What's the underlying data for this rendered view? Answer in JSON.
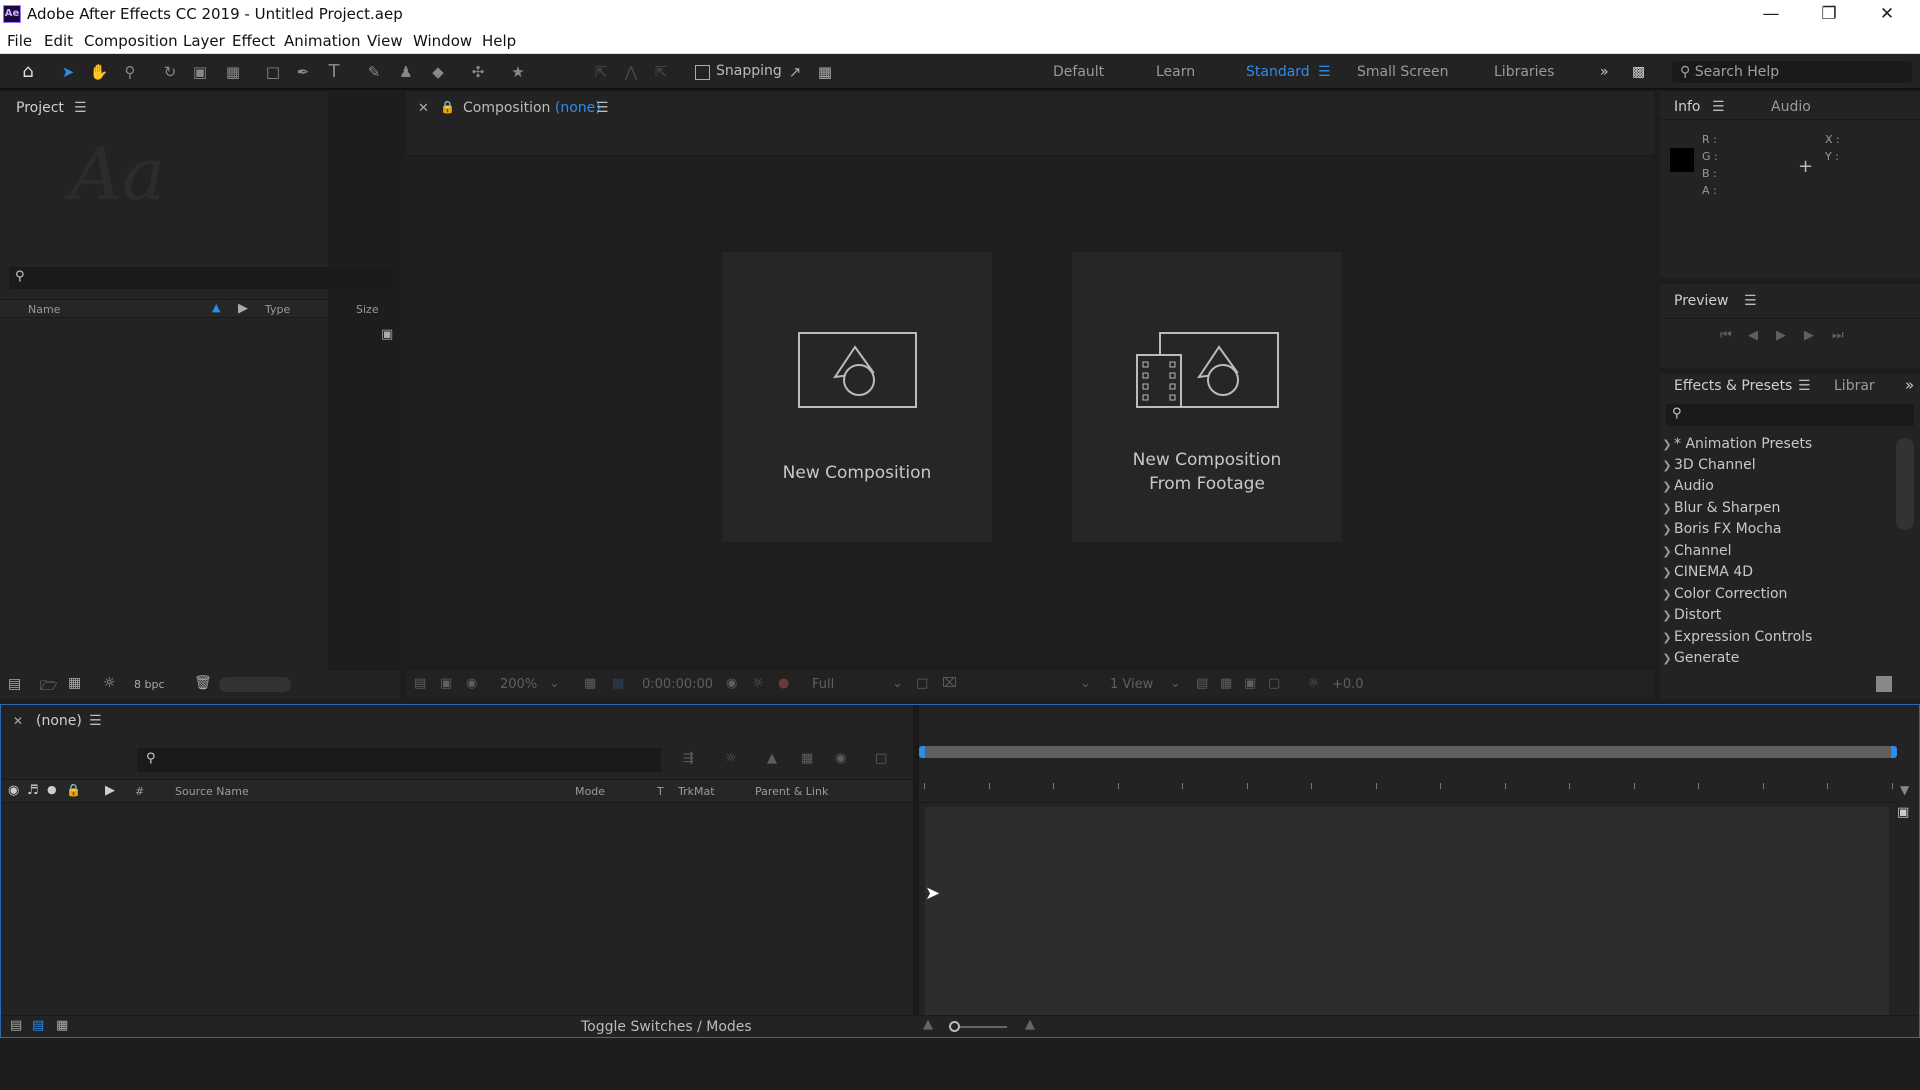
{
  "window": {
    "title": "Adobe After Effects CC 2019 - Untitled Project.aep",
    "app_icon": "Ae"
  },
  "menu": [
    "File",
    "Edit",
    "Composition",
    "Layer",
    "Effect",
    "Animation",
    "View",
    "Window",
    "Help"
  ],
  "toolbar": {
    "snapping_label": "Snapping",
    "workspaces": [
      {
        "label": "Default",
        "active": false
      },
      {
        "label": "Learn",
        "active": false
      },
      {
        "label": "Standard",
        "active": true
      },
      {
        "label": "Small Screen",
        "active": false
      },
      {
        "label": "Libraries",
        "active": false
      }
    ],
    "search_placeholder": "Search Help"
  },
  "project": {
    "title": "Project",
    "columns": {
      "name": "Name",
      "type": "Type",
      "size": "Size"
    },
    "bpc": "8 bpc"
  },
  "composition": {
    "title": "Composition",
    "title_none": "(none)",
    "new_comp": "New Composition",
    "new_comp_footage_line1": "New Composition",
    "new_comp_footage_line2": "From Footage",
    "zoom": "200%",
    "timecode": "0:00:00:00",
    "quality": "Full",
    "views": "1 View",
    "exposure": "+0.0"
  },
  "info": {
    "tab_info": "Info",
    "tab_audio": "Audio",
    "r": "R :",
    "g": "G :",
    "b": "B :",
    "a": "A :",
    "x": "X :",
    "y": "Y :",
    "swatch_color": "#000000"
  },
  "preview": {
    "title": "Preview"
  },
  "effects": {
    "title": "Effects & Presets",
    "tab_libraries": "Librar",
    "items": [
      "* Animation Presets",
      "3D Channel",
      "Audio",
      "Blur & Sharpen",
      "Boris FX Mocha",
      "Channel",
      "CINEMA 4D",
      "Color Correction",
      "Distort",
      "Expression Controls",
      "Generate"
    ]
  },
  "timeline": {
    "title": "(none)",
    "columns": {
      "hash": "#",
      "source_name": "Source Name",
      "mode": "Mode",
      "t": "T",
      "trkmat": "TrkMat",
      "parent": "Parent & Link"
    },
    "toggle_label": "Toggle Switches / Modes"
  },
  "colors": {
    "accent": "#2d8ceb",
    "panel": "#232323",
    "background": "#1d1d1d"
  }
}
